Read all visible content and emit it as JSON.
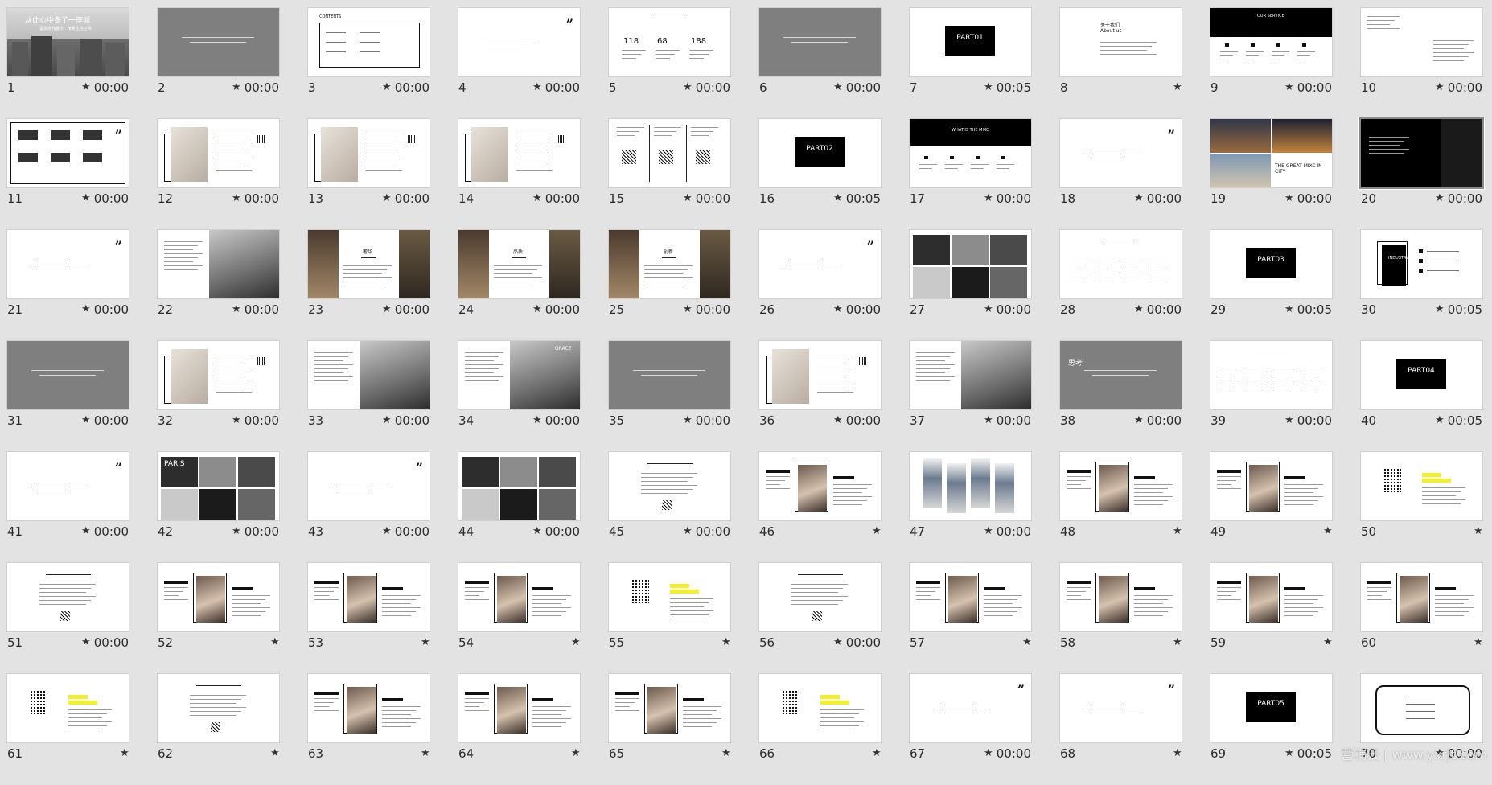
{
  "watermark": "营销云 | www.yxrjt.com",
  "slides": [
    {
      "n": "1",
      "t": "00:00",
      "k": "city",
      "title": "从此心中多了一座城",
      "sub": "呈现现代都市 · 精致生活空间"
    },
    {
      "n": "2",
      "t": "00:00",
      "k": "gray"
    },
    {
      "n": "3",
      "t": "00:00",
      "k": "contents",
      "title": "CONTENTS"
    },
    {
      "n": "4",
      "t": "00:00",
      "k": "quote"
    },
    {
      "n": "5",
      "t": "00:00",
      "k": "stats",
      "a": "118",
      "b": "68",
      "c": "188"
    },
    {
      "n": "6",
      "t": "00:00",
      "k": "gray"
    },
    {
      "n": "7",
      "t": "00:05",
      "k": "part",
      "label": "PART01"
    },
    {
      "n": "8",
      "t": "",
      "k": "about",
      "title": "关于我们",
      "sub": "About us"
    },
    {
      "n": "9",
      "t": "00:00",
      "k": "service",
      "title": "OUR SERVICE"
    },
    {
      "n": "10",
      "t": "00:00",
      "k": "text"
    },
    {
      "n": "11",
      "t": "00:00",
      "k": "logos"
    },
    {
      "n": "12",
      "t": "00:00",
      "k": "profile"
    },
    {
      "n": "13",
      "t": "00:00",
      "k": "profile"
    },
    {
      "n": "14",
      "t": "00:00",
      "k": "profile"
    },
    {
      "n": "15",
      "t": "00:00",
      "k": "qr3"
    },
    {
      "n": "16",
      "t": "00:05",
      "k": "part",
      "label": "PART02"
    },
    {
      "n": "17",
      "t": "00:00",
      "k": "whatis",
      "title": "WHAT IS THE MIXC"
    },
    {
      "n": "18",
      "t": "00:00",
      "k": "quote"
    },
    {
      "n": "19",
      "t": "00:00",
      "k": "great",
      "title": "THE GREAT MIXC IN CITY"
    },
    {
      "n": "20",
      "t": "00:00",
      "k": "black",
      "sel": true
    },
    {
      "n": "21",
      "t": "00:00",
      "k": "quote"
    },
    {
      "n": "22",
      "t": "00:00",
      "k": "photoR"
    },
    {
      "n": "23",
      "t": "00:00",
      "k": "split",
      "mid": "奢华"
    },
    {
      "n": "24",
      "t": "00:00",
      "k": "split",
      "mid": "品质"
    },
    {
      "n": "25",
      "t": "00:00",
      "k": "split",
      "mid": "创新"
    },
    {
      "n": "26",
      "t": "00:00",
      "k": "quote"
    },
    {
      "n": "27",
      "t": "00:00",
      "k": "mosaic"
    },
    {
      "n": "28",
      "t": "00:00",
      "k": "cols"
    },
    {
      "n": "29",
      "t": "00:05",
      "k": "part",
      "label": "PART03"
    },
    {
      "n": "30",
      "t": "00:05",
      "k": "industry",
      "title": "INDUSTRY"
    },
    {
      "n": "31",
      "t": "00:00",
      "k": "gray"
    },
    {
      "n": "32",
      "t": "00:00",
      "k": "profile"
    },
    {
      "n": "33",
      "t": "00:00",
      "k": "photoR"
    },
    {
      "n": "34",
      "t": "00:00",
      "k": "photoR",
      "title": "GRACE"
    },
    {
      "n": "35",
      "t": "00:00",
      "k": "gray"
    },
    {
      "n": "36",
      "t": "00:00",
      "k": "profile"
    },
    {
      "n": "37",
      "t": "00:00",
      "k": "photoR"
    },
    {
      "n": "38",
      "t": "00:00",
      "k": "gray",
      "title": "思考"
    },
    {
      "n": "39",
      "t": "00:00",
      "k": "cols"
    },
    {
      "n": "40",
      "t": "00:05",
      "k": "part",
      "label": "PART04"
    },
    {
      "n": "41",
      "t": "00:00",
      "k": "quote"
    },
    {
      "n": "42",
      "t": "00:00",
      "k": "mosaic",
      "title": "PARIS"
    },
    {
      "n": "43",
      "t": "00:00",
      "k": "quote"
    },
    {
      "n": "44",
      "t": "00:00",
      "k": "mosaic"
    },
    {
      "n": "45",
      "t": "00:00",
      "k": "qr1"
    },
    {
      "n": "46",
      "t": "",
      "k": "card"
    },
    {
      "n": "47",
      "t": "00:00",
      "k": "phones"
    },
    {
      "n": "48",
      "t": "",
      "k": "card"
    },
    {
      "n": "49",
      "t": "",
      "k": "card"
    },
    {
      "n": "50",
      "t": "",
      "k": "dots"
    },
    {
      "n": "51",
      "t": "00:00",
      "k": "qr1"
    },
    {
      "n": "52",
      "t": "",
      "k": "card"
    },
    {
      "n": "53",
      "t": "",
      "k": "card"
    },
    {
      "n": "54",
      "t": "",
      "k": "card"
    },
    {
      "n": "55",
      "t": "",
      "k": "dots"
    },
    {
      "n": "56",
      "t": "00:00",
      "k": "qr1"
    },
    {
      "n": "57",
      "t": "",
      "k": "card"
    },
    {
      "n": "58",
      "t": "",
      "k": "card"
    },
    {
      "n": "59",
      "t": "",
      "k": "card"
    },
    {
      "n": "60",
      "t": "",
      "k": "card"
    },
    {
      "n": "61",
      "t": "",
      "k": "dots"
    },
    {
      "n": "62",
      "t": "",
      "k": "qr1"
    },
    {
      "n": "63",
      "t": "",
      "k": "card"
    },
    {
      "n": "64",
      "t": "",
      "k": "card"
    },
    {
      "n": "65",
      "t": "",
      "k": "card"
    },
    {
      "n": "66",
      "t": "",
      "k": "dots"
    },
    {
      "n": "67",
      "t": "00:00",
      "k": "quote"
    },
    {
      "n": "68",
      "t": "",
      "k": "quote"
    },
    {
      "n": "69",
      "t": "00:05",
      "k": "part",
      "label": "PART05"
    },
    {
      "n": "70",
      "t": "00:00",
      "k": "list"
    }
  ]
}
